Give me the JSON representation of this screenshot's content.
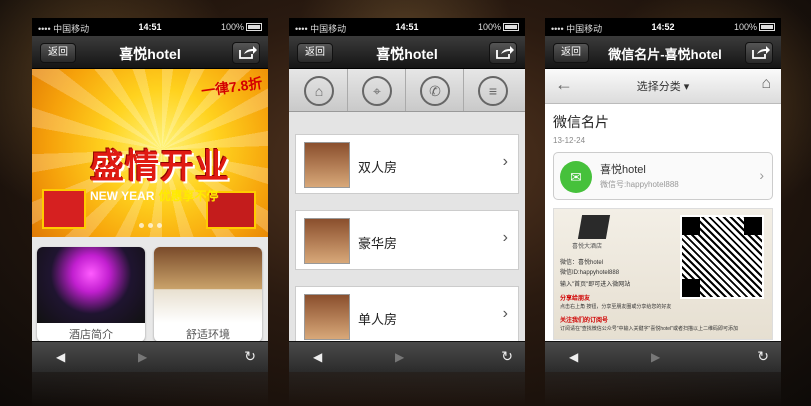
{
  "common": {
    "carrier": "•••• 中国移动",
    "battery": "100%",
    "back_label": "返回"
  },
  "phone1": {
    "time": "14:51",
    "title": "喜悦hotel",
    "banner": {
      "tag": "一律7.8折",
      "headline": "盛情开业",
      "newyear": "NEW YEAR",
      "promo": "优惠享不停"
    },
    "tiles": [
      {
        "caption": "酒店简介"
      },
      {
        "caption": "舒适环境"
      }
    ]
  },
  "phone2": {
    "time": "14:51",
    "title": "喜悦hotel",
    "icons": [
      "home-icon",
      "location-icon",
      "phone-icon",
      "list-icon"
    ],
    "rooms": [
      {
        "label": "双人房"
      },
      {
        "label": "豪华房"
      },
      {
        "label": "单人房"
      }
    ]
  },
  "phone3": {
    "time": "14:52",
    "title": "微信名片-喜悦hotel",
    "category": "选择分类",
    "heading": "微信名片",
    "date": "13-12-24",
    "card": {
      "name": "喜悦hotel",
      "account": "微信号:happyhotel888"
    },
    "poster": {
      "brand": "喜悦大酒店",
      "wechat": "微信：喜悦hotel",
      "wechat_id": "微信ID:happyhotel888",
      "instructions": "输入\"首页\"即可进入微网站",
      "share_title": "分享给朋友",
      "share_desc": "点击右上角  按钮，分享至朋友圈或分享给您的好友",
      "follow_title": "关注我们的订阅号",
      "follow_desc": "订阅请在\"查找微信公众号\"中输入关键字\"喜悦hotel\"或者扫描以上二维码即可添加"
    }
  }
}
